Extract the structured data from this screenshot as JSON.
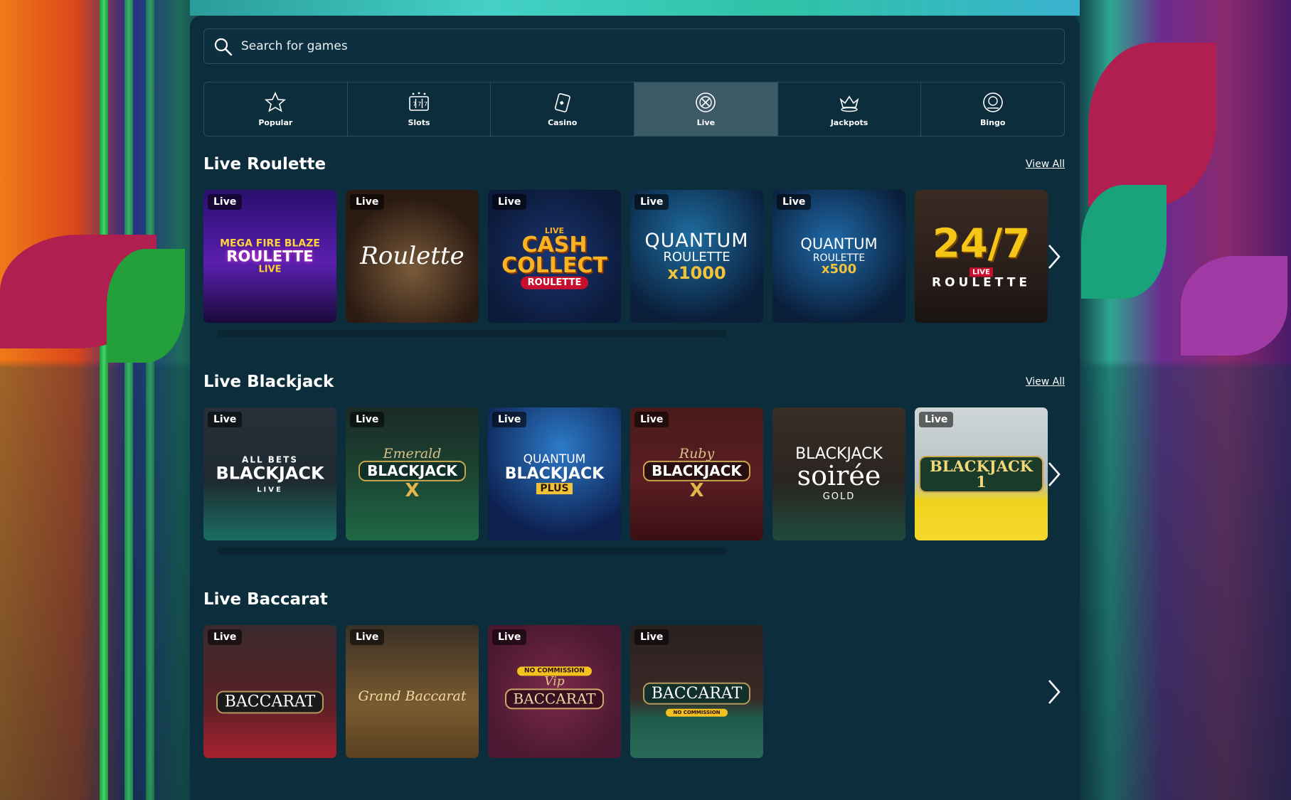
{
  "search": {
    "placeholder": "Search for games"
  },
  "tabs": [
    {
      "label": "Popular",
      "icon": "star-icon",
      "active": false
    },
    {
      "label": "Slots",
      "icon": "slot-machine-icon",
      "active": false
    },
    {
      "label": "Casino",
      "icon": "cards-icon",
      "active": false
    },
    {
      "label": "Live",
      "icon": "roulette-chip-icon",
      "active": true
    },
    {
      "label": "Jackpots",
      "icon": "crown-icon",
      "active": false
    },
    {
      "label": "Bingo",
      "icon": "bingo-ball-icon",
      "active": false
    }
  ],
  "badge": "Live",
  "view_all": "View All",
  "sections": [
    {
      "title": "Live Roulette",
      "games": [
        {
          "line1": "MEGA FIRE BLAZE",
          "line2": "ROULETTE",
          "line3": "LIVE"
        },
        {
          "line1": "Roulette"
        },
        {
          "line1": "LIVE",
          "line2": "CASH COLLECT",
          "line3": "ROULETTE"
        },
        {
          "line1": "QUANTUM",
          "line2": "ROULETTE",
          "line3": "x1000"
        },
        {
          "line1": "QUANTUM",
          "line2": "ROULETTE",
          "line3": "x500"
        },
        {
          "line1": "24/7",
          "line2": "ROULETTE",
          "line3": "LIVE"
        }
      ]
    },
    {
      "title": "Live Blackjack",
      "games": [
        {
          "line1": "ALL BETS",
          "line2": "BLACKJACK",
          "line3": "LIVE"
        },
        {
          "line1": "Emerald",
          "line2": "BLACKJACK",
          "line3": "X"
        },
        {
          "line1": "QUANTUM",
          "line2": "BLACKJACK",
          "line3": "PLUS"
        },
        {
          "line1": "Ruby",
          "line2": "BLACKJACK",
          "line3": "X"
        },
        {
          "line1": "BLACKJACK",
          "line2": "soirée",
          "line3": "GOLD"
        },
        {
          "line1": "BLACKJACK 1"
        }
      ]
    },
    {
      "title": "Live Baccarat",
      "games": [
        {
          "line1": "BACCARAT"
        },
        {
          "line1": "Grand Baccarat"
        },
        {
          "line1": "NO COMMISSION",
          "line2": "Vip",
          "line3": "BACCARAT"
        },
        {
          "line1": "BACCARAT",
          "line2": "NO COMMISSION"
        }
      ]
    }
  ]
}
